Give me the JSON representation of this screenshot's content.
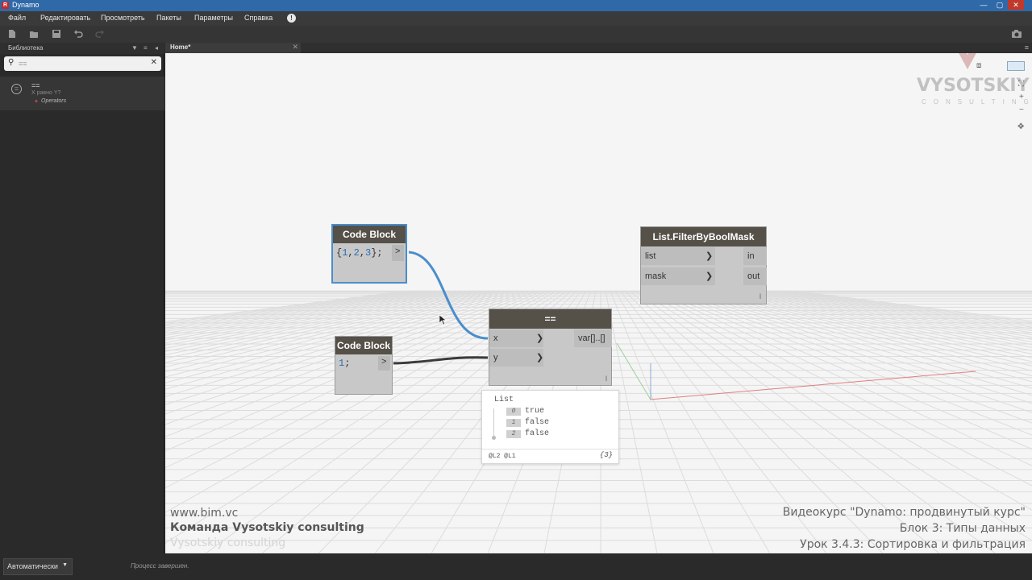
{
  "window": {
    "title": "Dynamo",
    "app_icon": "R",
    "minimize": "—",
    "maximize": "▢",
    "close": "✕"
  },
  "menu": [
    "Файл",
    "Редактировать",
    "Просмотреть",
    "Пакеты",
    "Параметры",
    "Справка"
  ],
  "menu_alert": "!",
  "library": {
    "title": "Библиотека",
    "search_value": "==",
    "result": {
      "name": "==",
      "description": "X равно Y?",
      "category": "Operators"
    }
  },
  "tab": {
    "label": "Home*"
  },
  "nodes": {
    "code_block_1": {
      "title": "Code Block",
      "code": "{1,2,3};",
      "out": ">"
    },
    "code_block_2": {
      "title": "Code Block",
      "code": "1;",
      "out": ">"
    },
    "equals": {
      "title": "==",
      "inputs": [
        "x",
        "y"
      ],
      "output": "var[]..[]",
      "lacing": "l"
    },
    "filter": {
      "title": "List.FilterByBoolMask",
      "inputs": [
        "list",
        "mask"
      ],
      "outputs": [
        "in",
        "out"
      ],
      "lacing": "l"
    }
  },
  "preview": {
    "title": "List",
    "items": [
      {
        "index": "0",
        "value": "true"
      },
      {
        "index": "1",
        "value": "false"
      },
      {
        "index": "2",
        "value": "false"
      }
    ],
    "levels": "@L2 @L1",
    "count": "{3}"
  },
  "watermark": {
    "brand": "VYSOTSKIY",
    "sub": "CONSULTING"
  },
  "captions": {
    "site": "www.bim.vc",
    "team": "Команда Vysotskiy consulting",
    "ghost": "Vysotskiy consulting",
    "course": "Видеокурс \"Dynamo: продвинутый курс\"",
    "block": "Блок 3: Типы данных",
    "lesson": "Урок 3.4.3: Сортировка и фильтрация"
  },
  "statusbar": {
    "run_mode": "Автоматически",
    "status": "Процесс завершен."
  },
  "colors": {
    "wire_selected": "#4a8ecc",
    "wire": "#3b3b3b",
    "node_header": "#555048",
    "node_body": "#c8c8c8"
  }
}
